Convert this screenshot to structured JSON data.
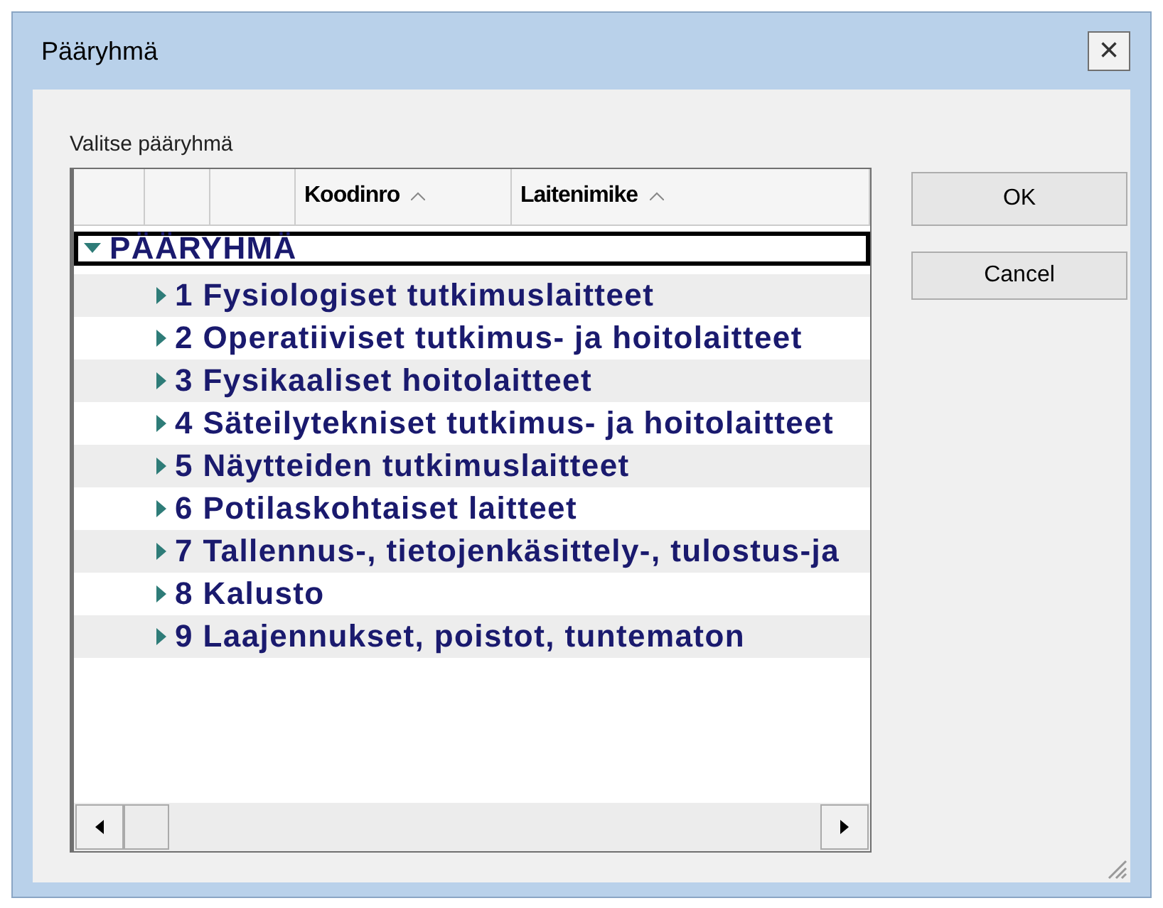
{
  "window": {
    "title": "Pääryhmä",
    "close": "×"
  },
  "label": "Valitse pääryhmä",
  "grid": {
    "columns": [
      {
        "sort": false
      },
      {
        "sort": false
      },
      {
        "sort": false
      },
      {
        "label": "Koodinro",
        "sort": true
      },
      {
        "label": "Laitenimike",
        "sort": true
      }
    ],
    "tree": [
      {
        "label": "PÄÄRYHMÄ",
        "expanded": true,
        "selected": true,
        "children": [
          {
            "label": "1 Fysiologiset tutkimuslaitteet",
            "expanded": false,
            "selected": false
          },
          {
            "label": "2 Operatiiviset tutkimus- ja hoitolaitteet",
            "expanded": false,
            "selected": false
          },
          {
            "label": "3 Fysikaaliset hoitolaitteet",
            "expanded": false,
            "selected": false
          },
          {
            "label": "4 Säteilytekniset tutkimus- ja hoitolaitteet",
            "expanded": false,
            "selected": false
          },
          {
            "label": "5 Näytteiden tutkimuslaitteet",
            "expanded": false,
            "selected": false
          },
          {
            "label": "6 Potilaskohtaiset laitteet",
            "expanded": false,
            "selected": false
          },
          {
            "label": "7 Tallennus-, tietojenkäsittely-, tulostus-ja",
            "expanded": false,
            "selected": false
          },
          {
            "label": "8 Kalusto",
            "expanded": false,
            "selected": false
          },
          {
            "label": "9 Laajennukset, poistot, tuntematon",
            "expanded": false,
            "selected": false
          }
        ]
      }
    ]
  },
  "buttons": [
    "OK",
    "Cancel"
  ]
}
